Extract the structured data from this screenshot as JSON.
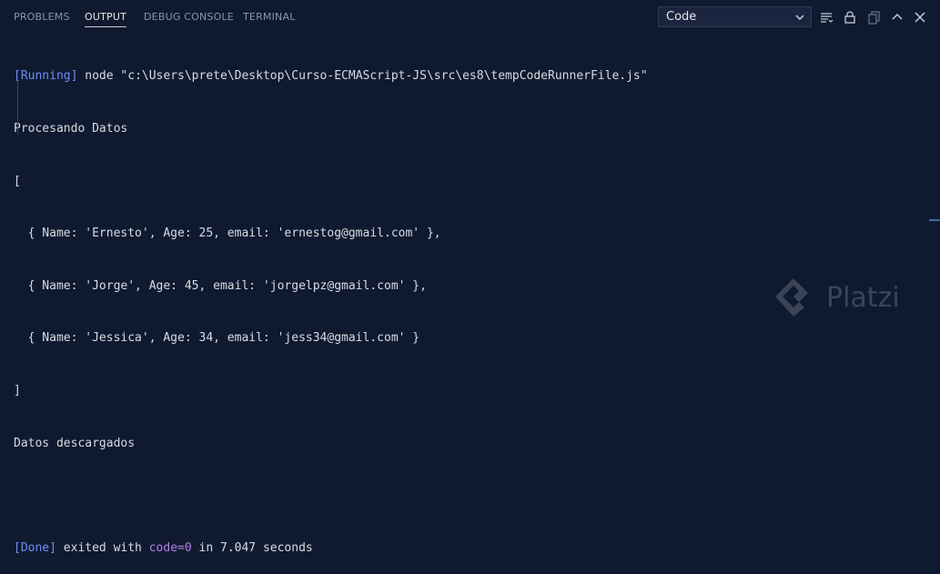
{
  "tabs": [
    {
      "label": "PROBLEMS",
      "active": false
    },
    {
      "label": "OUTPUT",
      "active": true
    },
    {
      "label": "DEBUG CONSOLE",
      "active": false
    },
    {
      "label": "TERMINAL",
      "active": false
    }
  ],
  "output_channel": {
    "selected": "Code"
  },
  "toolbar_icons": [
    "filter-lines-icon",
    "lock-icon",
    "copy-icon",
    "chevron-up-icon",
    "close-icon"
  ],
  "output": {
    "running_tag": "[Running]",
    "command": " node \"c:\\Users\\prete\\Desktop\\Curso-ECMAScript-JS\\src\\es8\\tempCodeRunnerFile.js\"",
    "line2": "Procesando Datos",
    "line3": "[",
    "line4": "  { Name: 'Ernesto', Age: 25, email: 'ernestog@gmail.com' },",
    "line5": "  { Name: 'Jorge', Age: 45, email: 'jorgelpz@gmail.com' },",
    "line6": "  { Name: 'Jessica', Age: 34, email: 'jess34@gmail.com' }",
    "line7": "]",
    "line8": "Datos descargados",
    "done_tag": "[Done]",
    "done_text1": " exited with ",
    "done_code": "code=0",
    "done_text2": " in 7.047 seconds"
  },
  "watermark": {
    "text": "Platzi"
  },
  "colors": {
    "background": "#0f1a30",
    "accent_blue": "#6c8ef5",
    "accent_purple": "#b57ee8"
  }
}
